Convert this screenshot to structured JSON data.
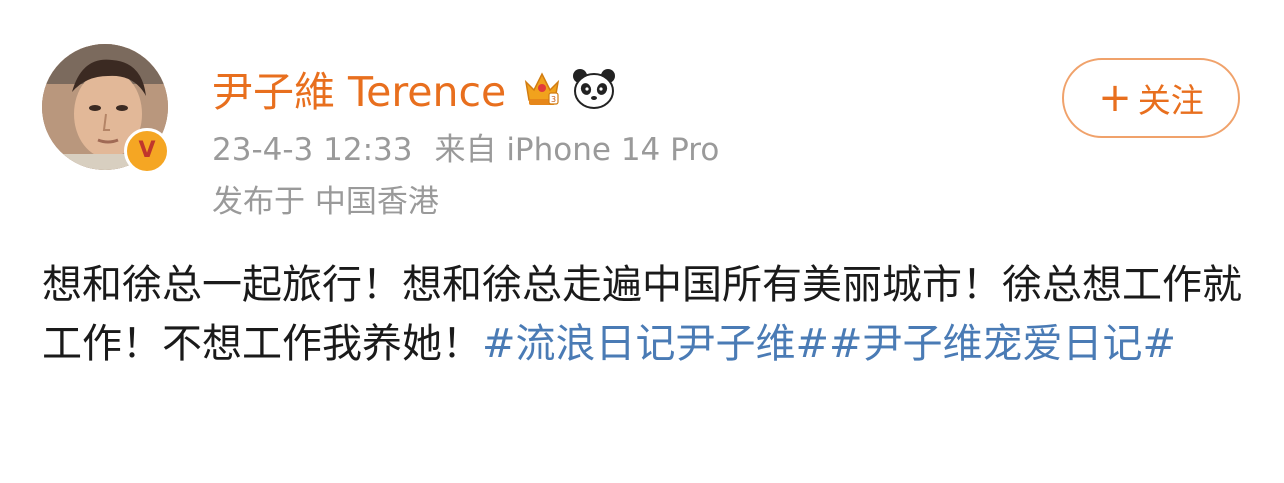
{
  "post": {
    "author": {
      "name": "尹子維 Terence",
      "verified_badge": "V",
      "badges": [
        "crown-icon",
        "panda-icon"
      ]
    },
    "timestamp": "23-4-3 12:33",
    "source": "来自 iPhone 14 Pro",
    "location": "发布于 中国香港",
    "follow_button": {
      "plus": "+",
      "label": "关注"
    },
    "content": {
      "text": "想和徐总一起旅行！想和徐总走遍中国所有美丽城市！徐总想工作就工作！不想工作我养她！",
      "hashtags": [
        "#流浪日记尹子维#",
        "#尹子维宠爱日记#"
      ]
    }
  },
  "colors": {
    "username": "#e86f1e",
    "meta": "#9a9a9a",
    "hashtag": "#4a7bb5",
    "follow_border": "#f0a26b",
    "badge": "#f5a623"
  }
}
